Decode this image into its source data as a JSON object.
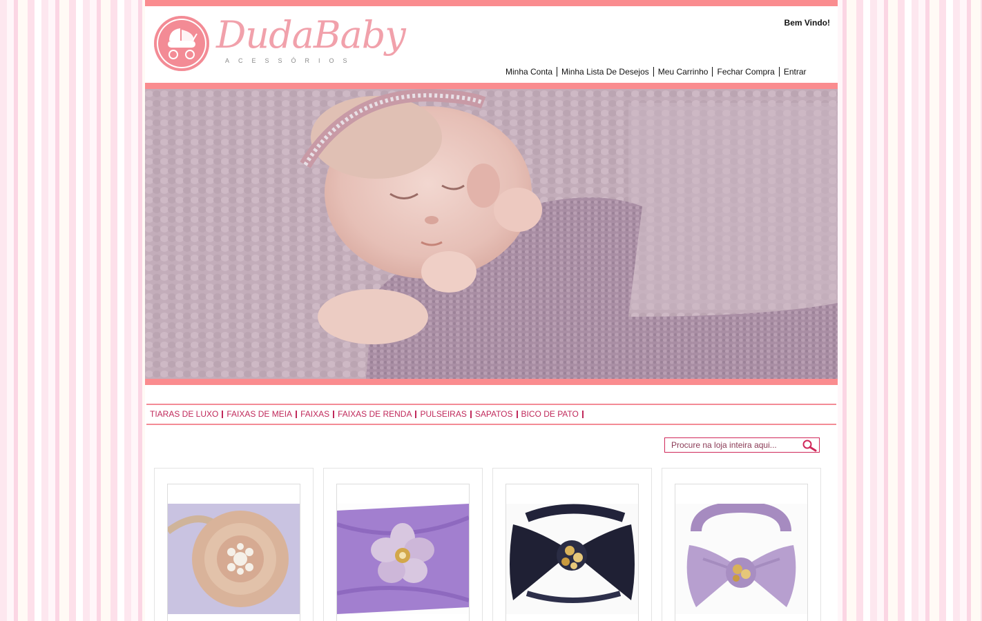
{
  "header": {
    "logo_text": "DudaBaby",
    "logo_subtitle": "ACESSÓRIOS",
    "welcome": "Bem Vindo!",
    "account_links": [
      "Minha Conta",
      "Minha Lista De Desejos",
      "Meu Carrinho",
      "Fechar Compra",
      "Entrar"
    ]
  },
  "banner": {
    "subject": "sleeping newborn baby with jeweled headband wrapped in lilac knit"
  },
  "categories": [
    "TIARAS DE LUXO",
    "FAIXAS DE MEIA",
    "FAIXAS",
    "FAIXAS DE RENDA",
    "PULSEIRAS",
    "SAPATOS",
    "BICO DE PATO"
  ],
  "search": {
    "placeholder": "Procure na loja inteira aqui...",
    "button_icon": "magnifier-icon"
  },
  "products": [
    {
      "image": "peach lace flower headband with pearl center"
    },
    {
      "image": "lilac stretch headband with satin flower"
    },
    {
      "image": "navy bow headband with crystal brooch"
    },
    {
      "image": "lavender bow headband with crystal brooch"
    }
  ],
  "colors": {
    "accent_pink": "#fa8c8f",
    "category_text": "#c0285a",
    "logo_pink": "#f1a1ab"
  }
}
